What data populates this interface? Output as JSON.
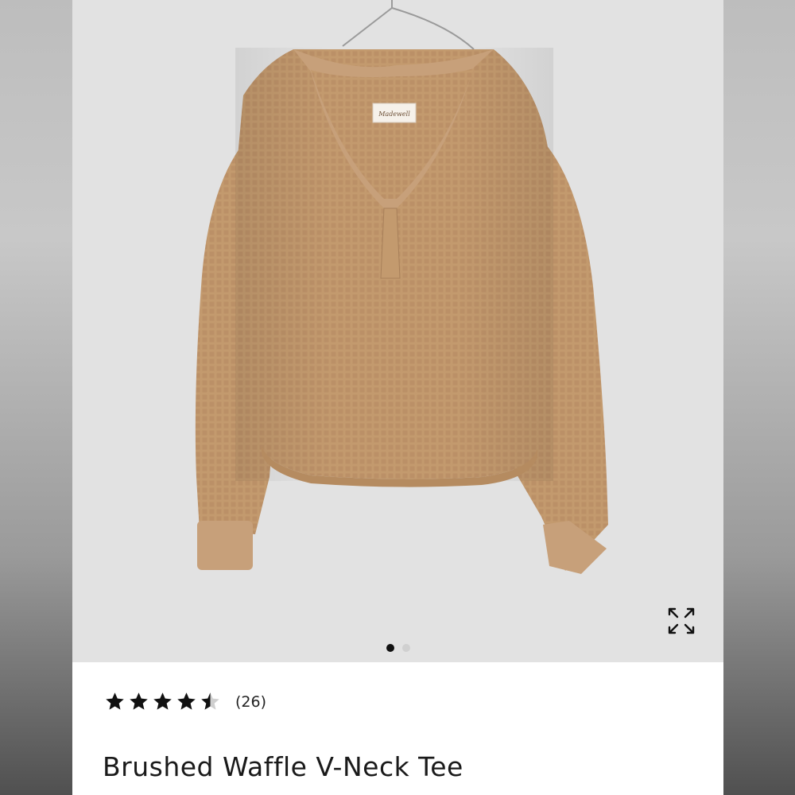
{
  "product": {
    "title": "Brushed Waffle V-Neck Tee",
    "label_text": "Madewell",
    "image_alt": "tan waffle-knit v-neck sweater on a hanger",
    "colors": {
      "garment": "#c39a6e",
      "background": "#e2e2e2"
    }
  },
  "gallery": {
    "image_count": 2,
    "current_index": 1,
    "expand_icon": "expand-arrows-icon"
  },
  "rating": {
    "stars": 4.5,
    "max_stars": 5,
    "review_count": "(26)"
  }
}
